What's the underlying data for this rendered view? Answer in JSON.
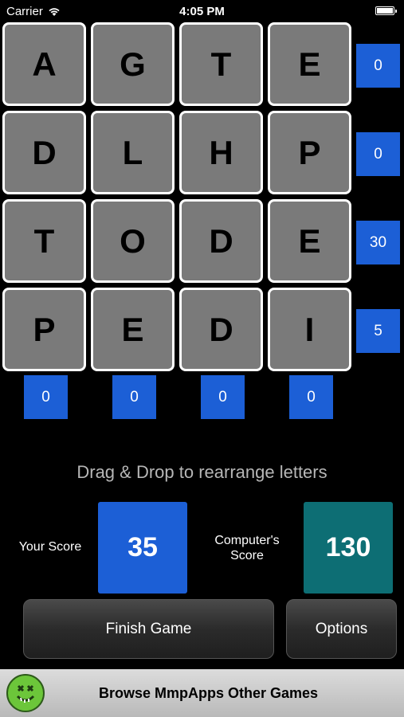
{
  "status": {
    "carrier": "Carrier",
    "time": "4:05 PM"
  },
  "board": {
    "rows": [
      [
        "A",
        "G",
        "T",
        "E"
      ],
      [
        "D",
        "L",
        "H",
        "P"
      ],
      [
        "T",
        "O",
        "D",
        "E"
      ],
      [
        "P",
        "E",
        "D",
        "I"
      ]
    ],
    "row_scores": [
      "0",
      "0",
      "30",
      "5"
    ],
    "col_scores": [
      "0",
      "0",
      "0",
      "0"
    ]
  },
  "hint": "Drag & Drop to rearrange letters",
  "scores": {
    "your_label": "Your Score",
    "your_value": "35",
    "computer_label_line1": "Computer's",
    "computer_label_line2": "Score",
    "computer_value": "130"
  },
  "buttons": {
    "finish": "Finish Game",
    "options": "Options"
  },
  "banner": {
    "text": "Browse MmpApps Other Games"
  },
  "colors": {
    "blue": "#1c5fd6",
    "teal": "#0d6e74",
    "tile": "#7a7a7a"
  }
}
